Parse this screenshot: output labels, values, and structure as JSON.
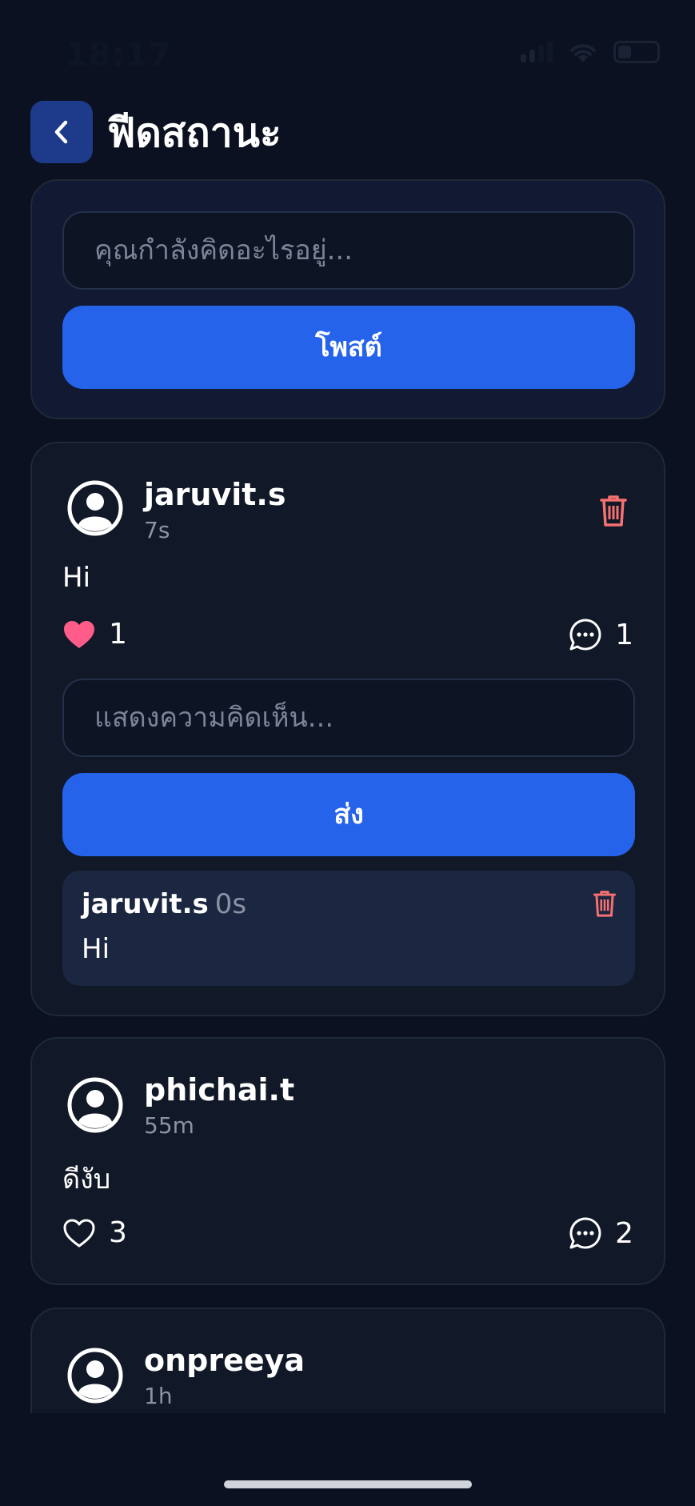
{
  "status_bar": {
    "time": "18:17",
    "icons": [
      "signal-icon",
      "wifi-icon",
      "battery-icon"
    ]
  },
  "header": {
    "back_icon": "chevron-left-icon",
    "title": "ฟีดสถานะ"
  },
  "composer": {
    "placeholder": "คุณกำลังคิดอะไรอยู่...",
    "post_label": "โพสต์"
  },
  "posts": [
    {
      "username": "jaruvit.s",
      "time": "7s",
      "text": "Hi",
      "likes": "1",
      "liked": true,
      "comments": "1",
      "can_delete": true,
      "comment_input": {
        "placeholder": "แสดงความคิดเห็น...",
        "send_label": "ส่ง"
      },
      "comment_list": [
        {
          "username": "jaruvit.s",
          "time": "0s",
          "text": "Hi"
        }
      ]
    },
    {
      "username": "phichai.t",
      "time": "55m",
      "text": "ดีงับ",
      "likes": "3",
      "liked": false,
      "comments": "2"
    },
    {
      "username": "onpreeya",
      "time": "1h"
    }
  ],
  "colors": {
    "background": "#0b1120",
    "card": "#111827",
    "accent": "#2563eb",
    "like": "#ff5c8a",
    "delete": "#f87171"
  }
}
